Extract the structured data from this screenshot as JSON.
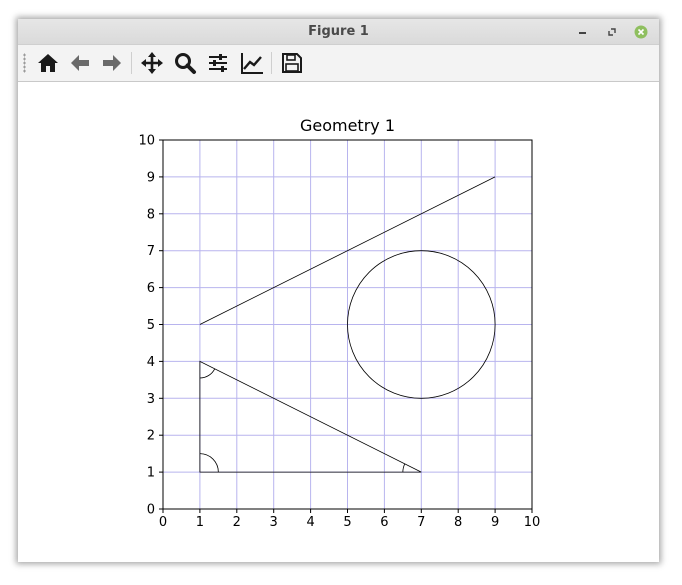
{
  "window": {
    "title": "Figure 1",
    "controls": {
      "minimize_icon": "minimize-icon",
      "maximize_icon": "restore-icon",
      "close_icon": "close-icon",
      "close_color": "#8fbf5f"
    }
  },
  "toolbar": {
    "buttons": [
      {
        "name": "home-icon"
      },
      {
        "name": "back-arrow-icon"
      },
      {
        "name": "forward-arrow-icon"
      },
      {
        "name": "pan-icon"
      },
      {
        "name": "zoom-icon"
      },
      {
        "name": "configure-subplots-icon"
      },
      {
        "name": "edit-axis-icon"
      },
      {
        "name": "save-icon"
      }
    ]
  },
  "chart_data": {
    "type": "geometry",
    "title": "Geometry 1",
    "xlim": [
      0,
      10
    ],
    "ylim": [
      0,
      10
    ],
    "xticks": [
      "0",
      "1",
      "2",
      "3",
      "4",
      "5",
      "6",
      "7",
      "8",
      "9",
      "10"
    ],
    "yticks": [
      "0",
      "1",
      "2",
      "3",
      "4",
      "5",
      "6",
      "7",
      "8",
      "9",
      "10"
    ],
    "grid": true,
    "grid_color": "#b8b4ee",
    "line_segment": {
      "from": [
        1,
        5
      ],
      "to": [
        9,
        9
      ]
    },
    "circle": {
      "center": [
        7,
        5
      ],
      "radius": 2
    },
    "triangle": {
      "vertices": [
        [
          1,
          1
        ],
        [
          7,
          1
        ],
        [
          1,
          4
        ]
      ]
    },
    "angle_marks": [
      {
        "vertex": [
          1,
          1
        ],
        "radius": 0.5,
        "from_deg": 0,
        "to_deg": 90
      },
      {
        "vertex": [
          1,
          4
        ],
        "radius": 0.45,
        "from_deg": -90,
        "to_deg": -26.57
      },
      {
        "vertex": [
          7,
          1
        ],
        "radius": 0.5,
        "from_deg": 153.43,
        "to_deg": 180
      }
    ]
  }
}
